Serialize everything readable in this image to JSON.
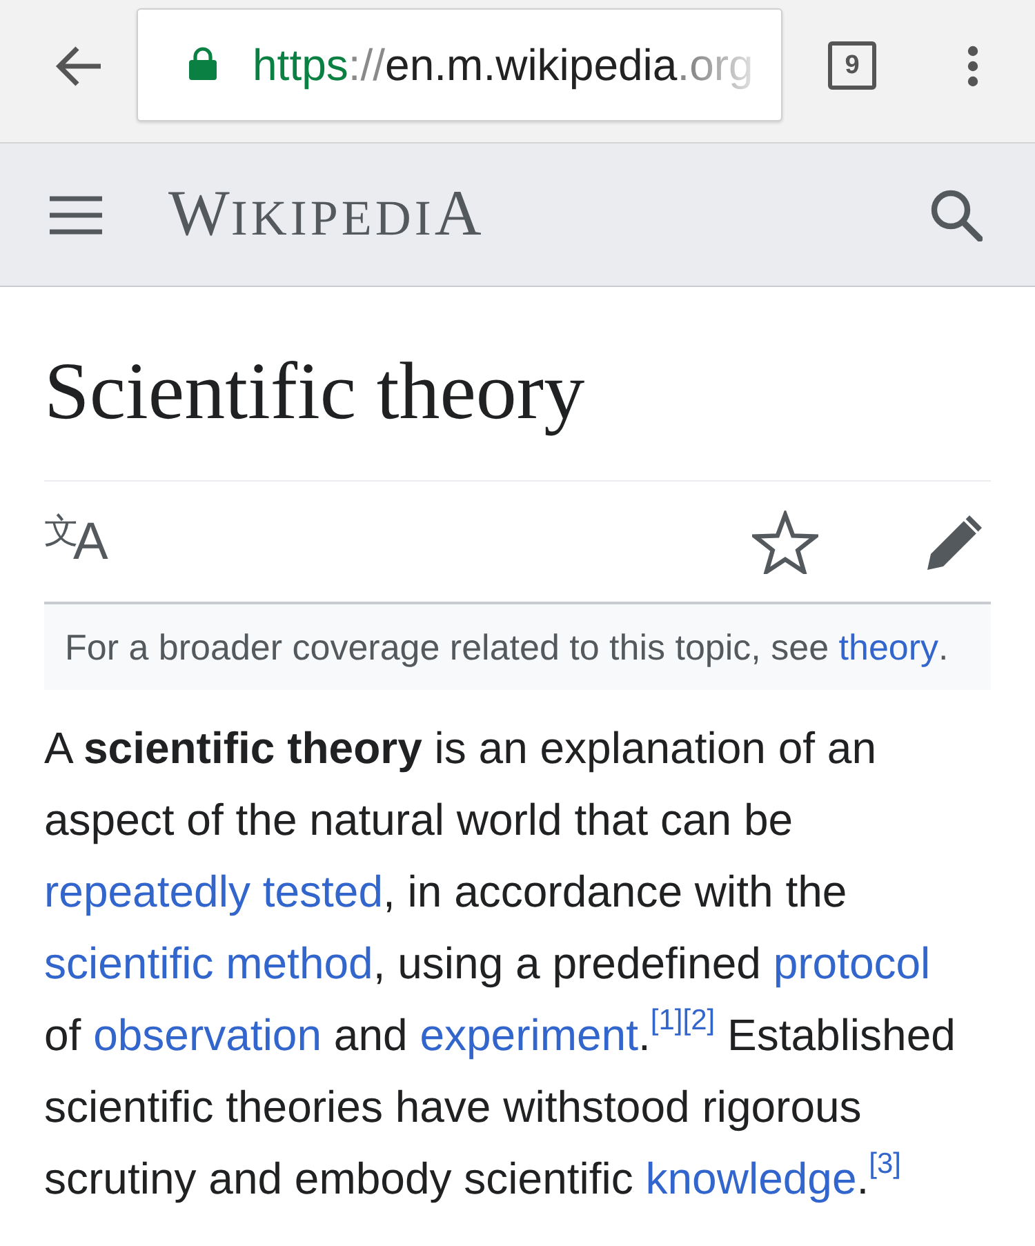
{
  "browser_bar": {
    "url": {
      "scheme": "https",
      "separator": "://",
      "host": "en.m.wikipedia",
      "rest": ".org"
    },
    "tab_count": "9"
  },
  "site_header": {
    "logo": "WIKIPEDIA"
  },
  "article": {
    "title": "Scientific theory",
    "language_button": "$^{文}$A",
    "watched": false,
    "hatnote": [
      {
        "kind": "text",
        "text": "For a broader coverage related to this topic, see "
      },
      {
        "kind": "link",
        "text": "theory"
      },
      {
        "kind": "text",
        "text": "."
      }
    ],
    "paragraph": [
      {
        "kind": "text",
        "text": "A **scientific theory** is an explanation of an aspect of the natural world that can be "
      },
      {
        "kind": "link",
        "text": "repeatedly tested"
      },
      {
        "kind": "text",
        "text": ", in accordance with the "
      },
      {
        "kind": "link",
        "text": "scientific method"
      },
      {
        "kind": "text",
        "text": ", using a predefined "
      },
      {
        "kind": "link",
        "text": "protocol"
      },
      {
        "kind": "text",
        "text": " of "
      },
      {
        "kind": "link",
        "text": "observation"
      },
      {
        "kind": "text",
        "text": " and "
      },
      {
        "kind": "link",
        "text": "experiment"
      },
      {
        "kind": "text",
        "text": "."
      },
      {
        "kind": "ref",
        "text": "[1]"
      },
      {
        "kind": "ref",
        "text": "[2]"
      },
      {
        "kind": "text",
        "text": " Established scientific theories have withstood rigorous scrutiny and embody scientific "
      },
      {
        "kind": "link",
        "text": "knowledge"
      },
      {
        "kind": "text",
        "text": "."
      },
      {
        "kind": "ref",
        "text": "[3]"
      }
    ]
  }
}
